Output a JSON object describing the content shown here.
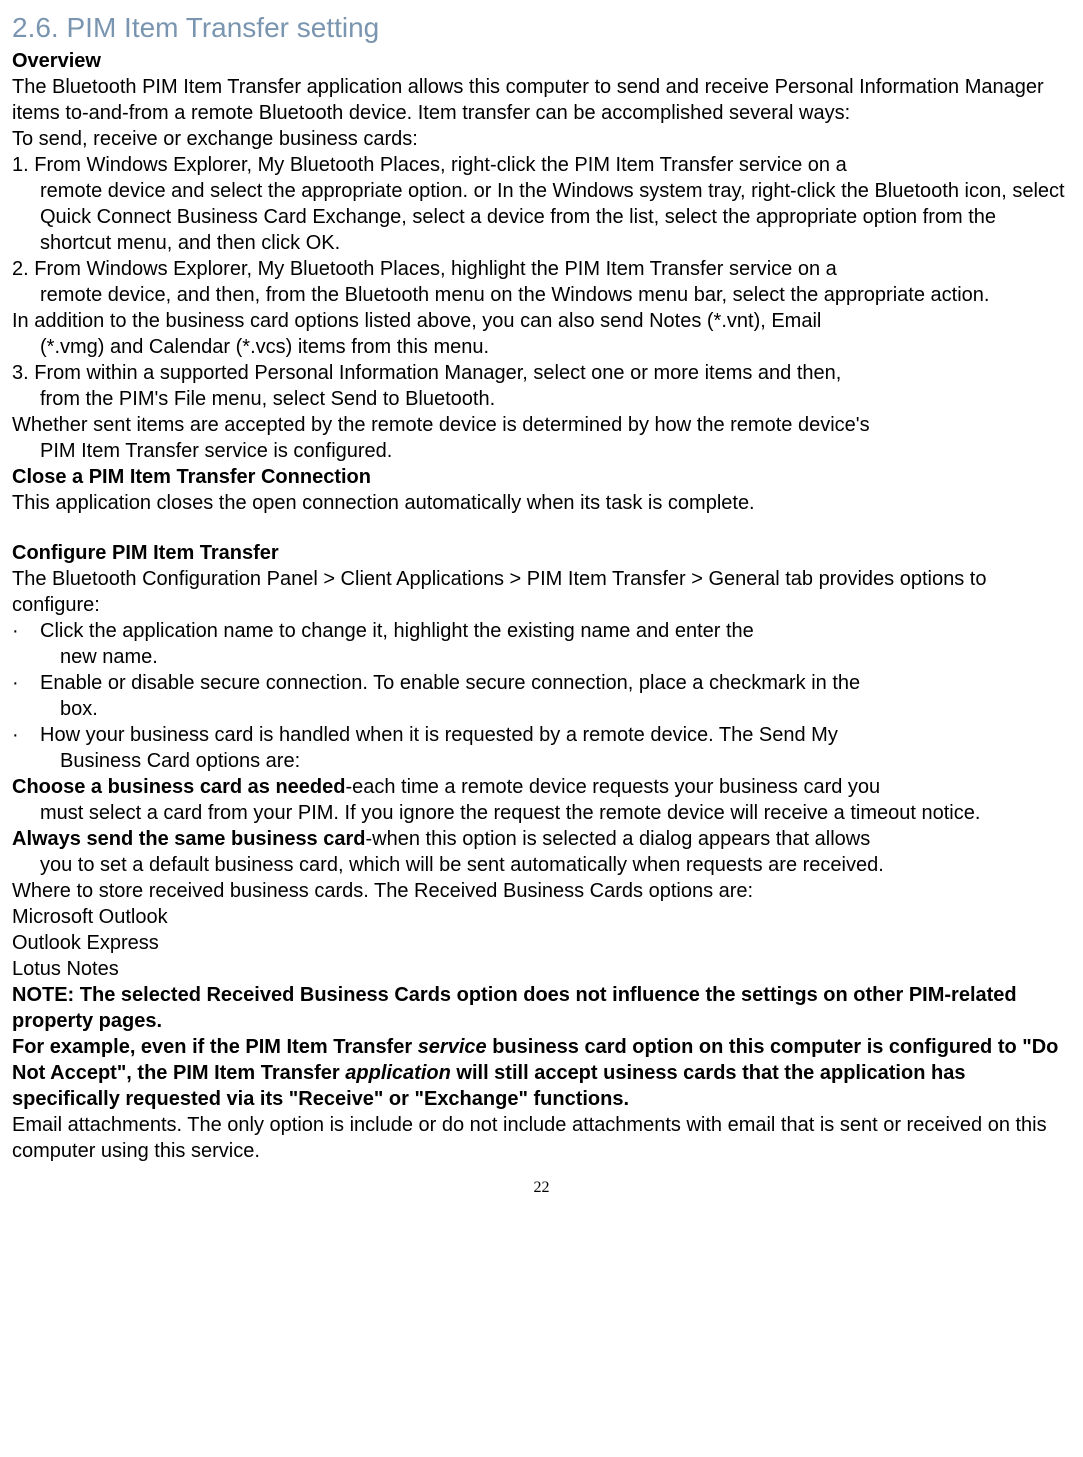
{
  "heading": "2.6. PIM Item Transfer setting",
  "overview_label": "Overview",
  "overview_p1": "The Bluetooth PIM Item Transfer application allows this computer to send and receive Personal Information Manager items to-and-from a remote Bluetooth device. Item transfer can be accomplished several ways:",
  "to_send_line": "To send, receive or exchange business cards:",
  "step1": "1. From Windows Explorer, My Bluetooth Places, right-click the PIM Item Transfer service on a remote device and select the appropriate option. or In the Windows system tray, right-click the Bluetooth icon, select Quick Connect Business Card Exchange, select a device from the list, select the appropriate option from the shortcut menu, and then click OK.",
  "step1_a": "1. From Windows Explorer, My Bluetooth Places, right-click the PIM Item Transfer service on a",
  "step1_b": "remote device and select the appropriate option. or In the Windows system tray, right-click the Bluetooth icon, select Quick Connect Business Card Exchange, select a device from the list, select the appropriate option from the shortcut menu, and then click OK.",
  "step2_a": "2. From Windows Explorer, My Bluetooth Places, highlight the PIM Item Transfer service on a",
  "step2_b": "remote device, and then, from the Bluetooth menu on the Windows menu bar, select the appropriate action.",
  "in_addition_a": "In addition to the business card options listed above, you can also send Notes (*.vnt), Email",
  "in_addition_b": "(*.vmg) and Calendar (*.vcs) items from this menu.",
  "step3_a": "3. From within a supported Personal Information Manager, select one or more items and then,",
  "step3_b": "from the PIM's File menu, select Send to Bluetooth.",
  "whether_a": "Whether sent items are accepted by the remote device is determined by how the remote device's",
  "whether_b": "PIM Item Transfer service is configured.",
  "close_heading": "Close a PIM Item Transfer Connection",
  "close_text": "This application closes the open connection automatically when its task is complete.",
  "configure_heading": "Configure PIM Item Transfer",
  "configure_text": "The Bluetooth Configuration Panel > Client Applications > PIM Item Transfer > General tab provides options to configure:",
  "bullet1_a": "Click the application name to change it, highlight the existing name and enter the",
  "bullet1_b": "new name.",
  "bullet2_a": "Enable or disable secure connection. To enable secure connection, place a checkmark in the",
  "bullet2_b": "box.",
  "bullet3_a": "How your business card is handled when it is requested by a remote device. The Send My",
  "bullet3_b": "Business Card options are:",
  "choose_bold": "Choose a business card as needed",
  "choose_rest": "-each time a remote device requests your business card you",
  "choose_b": "must select a card from your PIM. If you ignore the request the remote device will receive a timeout notice.",
  "always_bold": "Always send the same business card",
  "always_rest": "-when this option is selected a dialog appears that allows",
  "always_b": "you to set a default business card, which will be sent automatically when requests are received.",
  "where_line": "Where to store received business cards. The Received Business Cards options are:",
  "opt1": "Microsoft Outlook",
  "opt2": "Outlook Express",
  "opt3": "Lotus Notes",
  "note_line1": "NOTE: The selected Received Business Cards option does not influence the settings on other PIM-related property pages.",
  "note_line2a": "For example, even if the PIM Item Transfer ",
  "note_service": "service",
  "note_line2b": " business card option on this computer is configured to \"Do Not Accept\", the PIM Item Transfer ",
  "note_application": "application",
  "note_line2c": " will still accept usiness cards that the application has specifically requested via its \"Receive\" or \"Exchange\" functions.",
  "email_line": "Email attachments. The only option is include or do not include attachments with email that is sent or received on this computer using this service.",
  "page_number": "22",
  "bullet_char": "·"
}
